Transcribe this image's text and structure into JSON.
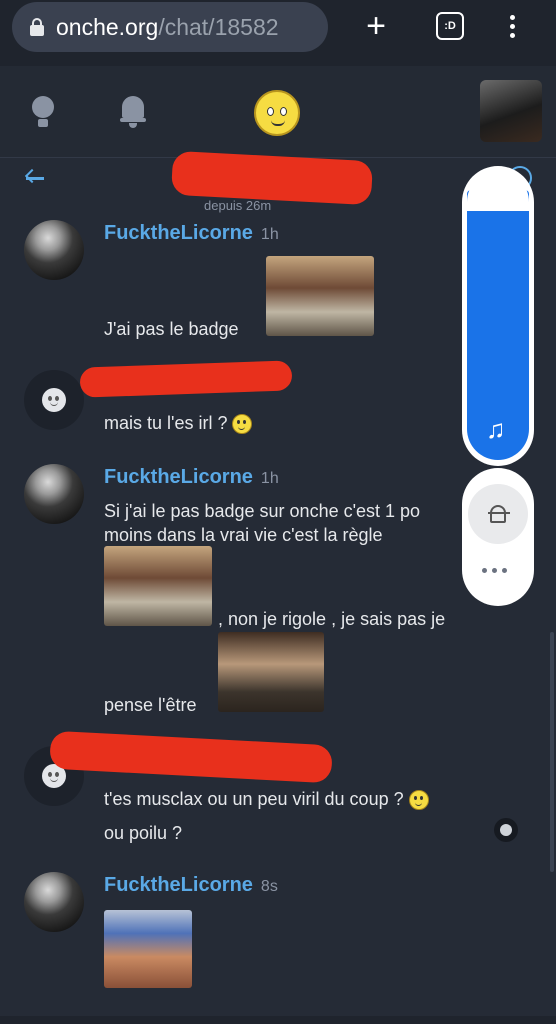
{
  "browser": {
    "url_domain": "onche.org",
    "url_path": "/chat/18582",
    "tab_label": ":D"
  },
  "topic": {
    "subtitle": "depuis 26m"
  },
  "messages": [
    {
      "author": "FucktheLicorne",
      "time": "1h",
      "lines": [
        "J'ai pas le badge"
      ]
    },
    {
      "author": "",
      "time": "",
      "lines": [
        "mais tu l'es irl ?"
      ]
    },
    {
      "author": "FucktheLicorne",
      "time": "1h",
      "lines": [
        "Si j'ai le pas badge sur onche c'est 1 po",
        "moins dans la vrai vie c'est la règle",
        ", non je rigole , je sais pas je",
        "pense l'être"
      ]
    },
    {
      "author": "",
      "time": "",
      "lines": [
        "t'es musclax ou un peu viril du coup ?",
        "ou poilu ?"
      ]
    },
    {
      "author": "FucktheLicorne",
      "time": "8s",
      "lines": []
    }
  ],
  "icons": {
    "lightbulb": "lightbulb-icon",
    "bell": "bell-icon",
    "smiley": "smiley-icon",
    "music": "music-note-icon",
    "mute": "bell-off-icon"
  },
  "colors": {
    "accent": "#5aa9e6",
    "background": "#252b36",
    "media_fill": "#1a73e8"
  },
  "media_panel": {
    "volume_level": 0.93
  }
}
